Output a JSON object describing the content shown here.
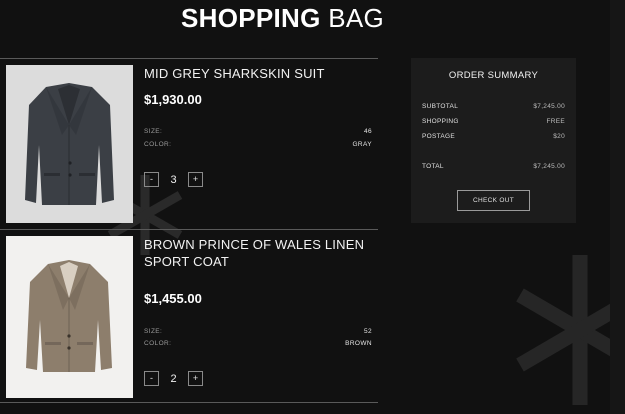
{
  "header": {
    "title_bold": "SHOPPING",
    "title_light": "BAG"
  },
  "items": [
    {
      "name": "MID GREY SHARKSKIN SUIT",
      "price": "$1,930.00",
      "size_label": "SIZE:",
      "size_value": "46",
      "color_label": "COLOR:",
      "color_value": "GRAY",
      "minus": "-",
      "qty": "3",
      "plus": "+"
    },
    {
      "name": "BROWN PRINCE OF WALES LINEN SPORT COAT",
      "price": "$1,455.00",
      "size_label": "SIZE:",
      "size_value": "52",
      "color_label": "COLOR:",
      "color_value": "BROWN",
      "minus": "-",
      "qty": "2",
      "plus": "+"
    }
  ],
  "summary": {
    "title": "ORDER SUMMARY",
    "rows": [
      {
        "label": "SUBTOTAL",
        "value": "$7,245.00"
      },
      {
        "label": "SHOPPING",
        "value": "FREE"
      },
      {
        "label": "POSTAGE",
        "value": "$20"
      },
      {
        "label": "TOTAL",
        "value": "$7,245.00"
      }
    ],
    "checkout_label": "CHECK OUT"
  },
  "colors": {
    "background": "#111111",
    "panel": "#1c1c1c",
    "suit_grey": "#3a3e44",
    "coat_brown": "#8a7a68"
  },
  "icons": [
    "asterisk-decoration-icon"
  ]
}
